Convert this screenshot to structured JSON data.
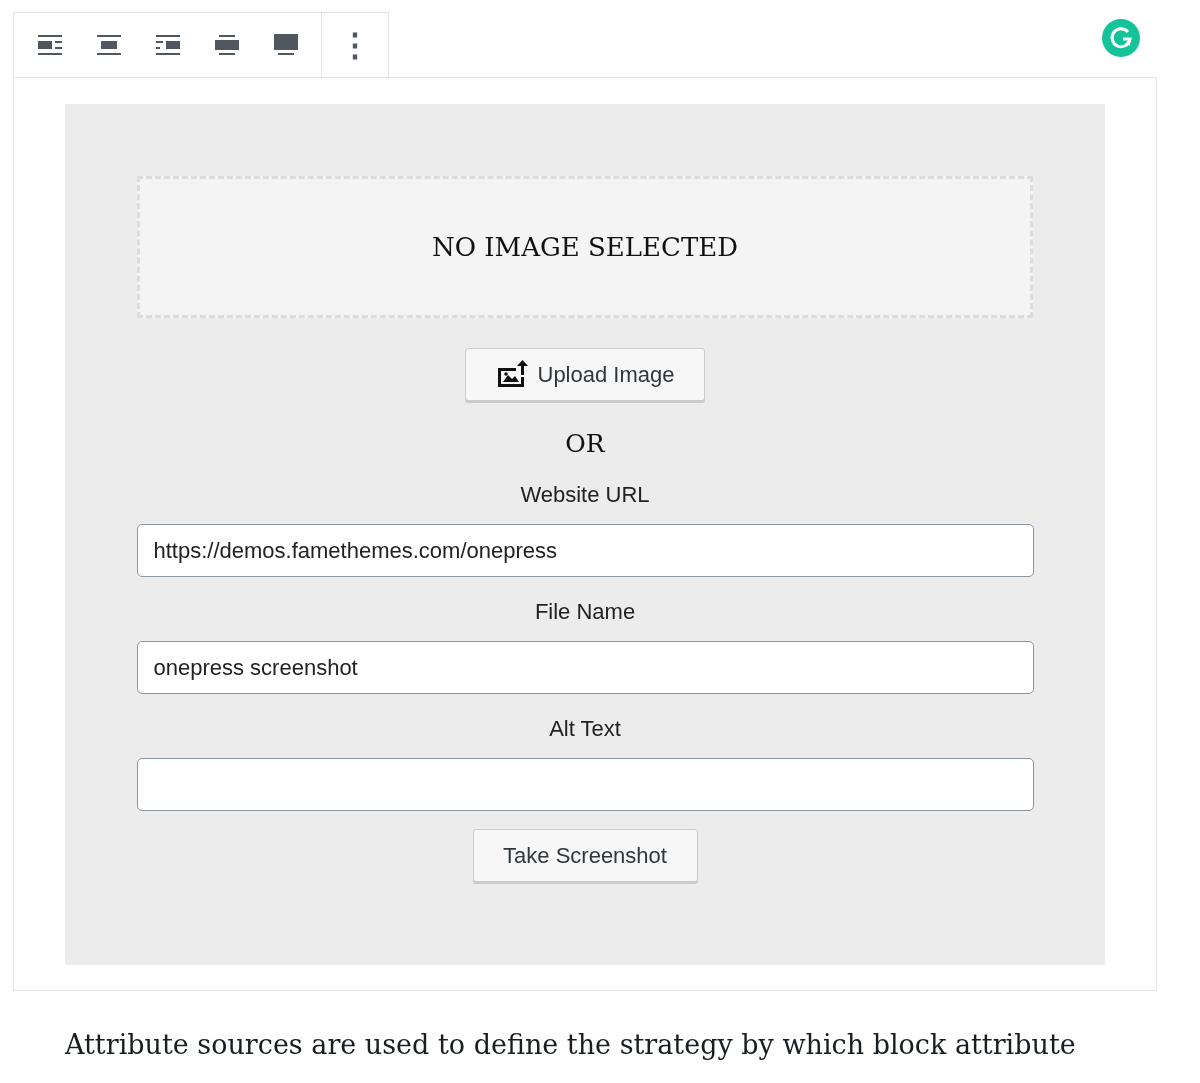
{
  "block_toolbar": {
    "align_buttons": [
      {
        "kind": "left"
      },
      {
        "kind": "center"
      },
      {
        "kind": "right"
      },
      {
        "kind": "wide"
      },
      {
        "kind": "full"
      }
    ],
    "more_button": "⋮"
  },
  "block": {
    "placeholder_text": "NO IMAGE SELECTED",
    "upload_button": "Upload Image",
    "separator": "OR",
    "fields": [
      {
        "label": "Website URL",
        "value": "https://demos.famethemes.com/onepress"
      },
      {
        "label": "File Name",
        "value": "onepress screenshot"
      },
      {
        "label": "Alt Text"
      }
    ],
    "submit_button": "Take Screenshot"
  },
  "paragraph": "Attribute sources are used to define the strategy by which block attribute"
}
